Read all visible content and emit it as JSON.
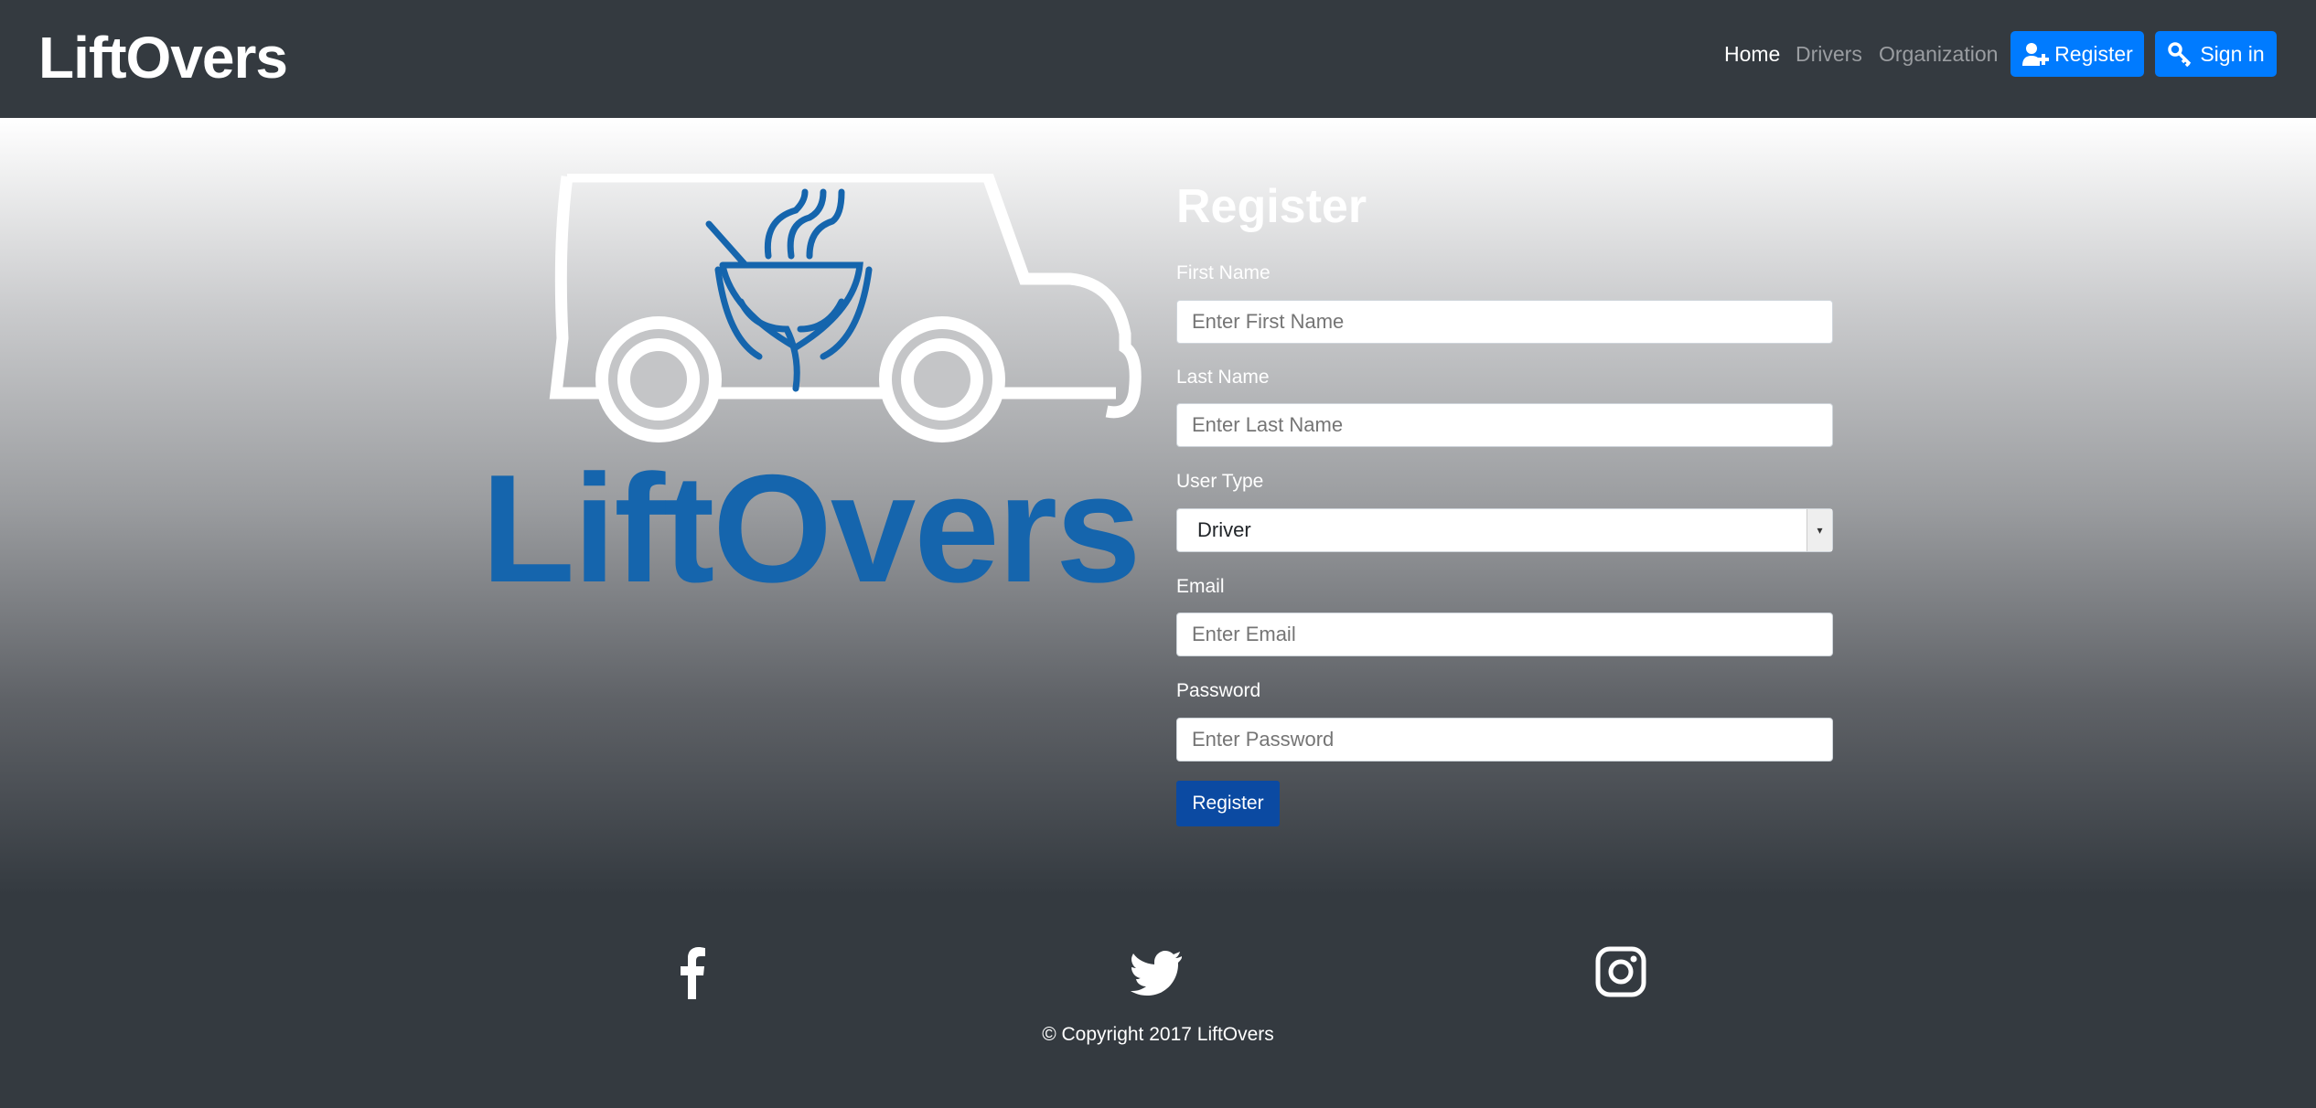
{
  "navbar": {
    "brand": "LiftOvers",
    "links": [
      "Home",
      "Drivers",
      "Organization"
    ],
    "register_label": "Register",
    "signin_label": "Sign in"
  },
  "logo": {
    "text": "LiftOvers"
  },
  "form": {
    "title": "Register",
    "first_name": {
      "label": "First Name",
      "placeholder": "Enter First Name"
    },
    "last_name": {
      "label": "Last Name",
      "placeholder": "Enter Last Name"
    },
    "user_type": {
      "label": "User Type",
      "value": "Driver"
    },
    "email": {
      "label": "Email",
      "placeholder": "Enter Email"
    },
    "password": {
      "label": "Password",
      "placeholder": "Enter Password"
    },
    "submit_label": "Register"
  },
  "footer": {
    "copyright": "© Copyright 2017 LiftOvers",
    "icons": [
      "facebook-icon",
      "twitter-icon",
      "instagram-icon"
    ]
  },
  "colors": {
    "navbar": "#343a40",
    "primary": "#007bff",
    "logo_blue": "#1565ad",
    "submit": "#0b4aa2"
  }
}
